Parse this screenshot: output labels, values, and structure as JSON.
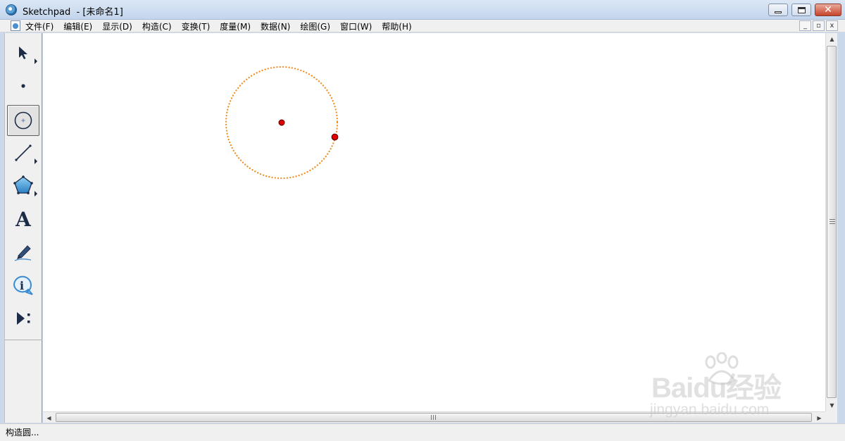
{
  "window": {
    "app_name": "Sketchpad",
    "title": "Sketchpad  - [未命名1]",
    "minimize_icon": "minimize-icon",
    "maximize_icon": "maximize-icon",
    "close_icon": "close-icon"
  },
  "menu": {
    "items": [
      "文件(F)",
      "编辑(E)",
      "显示(D)",
      "构造(C)",
      "变换(T)",
      "度量(M)",
      "数据(N)",
      "绘图(G)",
      "窗口(W)",
      "帮助(H)"
    ],
    "doc_controls": [
      "_",
      "▫",
      "x"
    ]
  },
  "toolbox": {
    "tools": [
      {
        "name": "arrow-tool",
        "icon": "arrow-select-icon",
        "has_submenu": true,
        "selected": false
      },
      {
        "name": "point-tool",
        "icon": "point-icon",
        "has_submenu": false,
        "selected": false
      },
      {
        "name": "compass-tool",
        "icon": "circle-icon",
        "has_submenu": false,
        "selected": true
      },
      {
        "name": "straightedge-tool",
        "icon": "segment-icon",
        "has_submenu": true,
        "selected": false
      },
      {
        "name": "polygon-tool",
        "icon": "polygon-icon",
        "has_submenu": true,
        "selected": false
      },
      {
        "name": "text-tool",
        "icon": "text-icon",
        "label": "A",
        "has_submenu": false,
        "selected": false
      },
      {
        "name": "marker-tool",
        "icon": "marker-pen-icon",
        "has_submenu": false,
        "selected": false
      },
      {
        "name": "info-tool",
        "icon": "info-icon",
        "label": "i",
        "has_submenu": false,
        "selected": false
      },
      {
        "name": "custom-tool",
        "icon": "custom-tools-icon",
        "has_submenu": false,
        "selected": false
      }
    ]
  },
  "canvas": {
    "circle": {
      "style": "dotted",
      "color": "#f08a1c"
    },
    "center_point": {
      "color": "#e00000"
    },
    "radius_point": {
      "color": "#e00000"
    }
  },
  "status": {
    "text": "构造圆..."
  },
  "watermark": {
    "brand": "Baidu经验",
    "url": "jingyan.baidu.com"
  }
}
